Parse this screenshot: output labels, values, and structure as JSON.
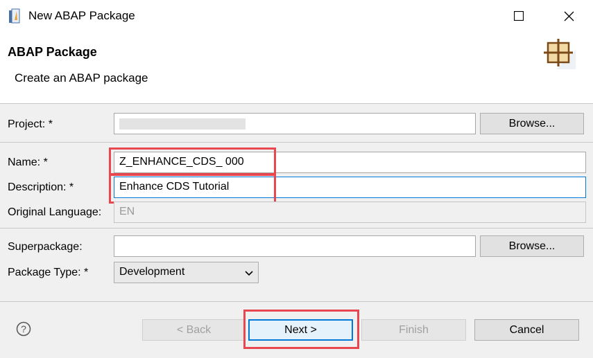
{
  "window": {
    "title": "New ABAP Package"
  },
  "header": {
    "title": "ABAP Package",
    "description": "Create an ABAP package"
  },
  "form": {
    "project_label": "Project: *",
    "project_value": "",
    "browse_label": "Browse...",
    "name_label": "Name: *",
    "name_value": "Z_ENHANCE_CDS_ 000",
    "description_label": "Description: *",
    "description_value": "Enhance CDS Tutorial",
    "language_label": "Original Language:",
    "language_value": "EN",
    "superpackage_label": "Superpackage:",
    "superpackage_value": "",
    "superpackage_browse_label": "Browse...",
    "package_type_label": "Package Type: *",
    "package_type_value": "Development"
  },
  "footer": {
    "back_label": "< Back",
    "next_label": "Next >",
    "finish_label": "Finish",
    "cancel_label": "Cancel"
  },
  "colors": {
    "highlight": "#e8474f",
    "focus": "#0078d7"
  }
}
